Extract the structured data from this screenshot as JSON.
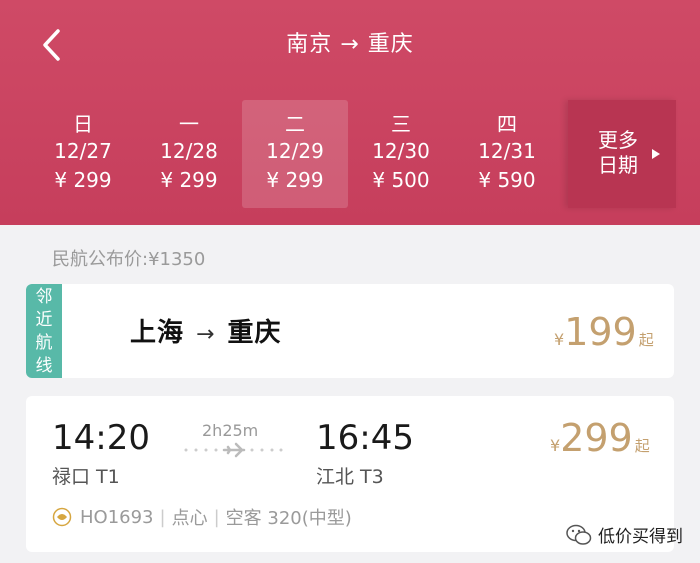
{
  "header": {
    "title": "南京 → 重庆",
    "more_dates_line1": "更多",
    "more_dates_line2": "日期"
  },
  "dates": [
    {
      "weekday": "日",
      "date": "12/27",
      "price": "¥ 299",
      "selected": false
    },
    {
      "weekday": "一",
      "date": "12/28",
      "price": "¥ 299",
      "selected": false
    },
    {
      "weekday": "二",
      "date": "12/29",
      "price": "¥ 299",
      "selected": true
    },
    {
      "weekday": "三",
      "date": "12/30",
      "price": "¥ 500",
      "selected": false
    },
    {
      "weekday": "四",
      "date": "12/31",
      "price": "¥ 590",
      "selected": false
    }
  ],
  "official_price": "民航公布价:¥1350",
  "nearby_card": {
    "tag_chars": [
      "邻",
      "近",
      "航",
      "线"
    ],
    "from": "上海",
    "arrow": "→",
    "to": "重庆",
    "currency": "¥",
    "price": "199",
    "suffix": "起"
  },
  "flight_card": {
    "dep_time": "14:20",
    "dep_airport": "禄口 T1",
    "duration": "2h25m",
    "arr_time": "16:45",
    "arr_airport": "江北 T3",
    "currency": "¥",
    "price": "299",
    "suffix": "起",
    "flight_no": "HO1693",
    "meal": "点心",
    "aircraft": "空客 320(中型)",
    "separator": "|"
  },
  "watermark": {
    "text": "低价买得到"
  },
  "colors": {
    "header": "#c94360",
    "accent_price": "#c4a06f",
    "tag": "#58b9a8"
  },
  "icons": {
    "back": "chevron-left-icon",
    "more": "triangle-right-icon",
    "plane": "airplane-icon",
    "airline": "airline-logo-icon",
    "wechat": "wechat-icon"
  }
}
